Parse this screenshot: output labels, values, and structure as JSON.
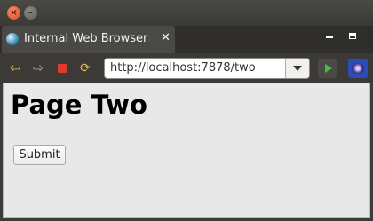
{
  "window": {
    "close_glyph": "×",
    "minimize_glyph": "–"
  },
  "tab": {
    "title": "Internal Web Browser",
    "close_glyph": "✕"
  },
  "toolbar": {
    "back_glyph": "⇦",
    "forward_glyph": "⇨",
    "refresh_glyph": "⟳",
    "url": "http://localhost:7878/two"
  },
  "page": {
    "heading": "Page Two",
    "submit_label": "Submit"
  },
  "colors": {
    "titlebar": "#3c3b37",
    "content_bg": "#e8e8e8",
    "close_button": "#df4a1f",
    "stop_button": "#e03a2c",
    "go_button": "#3fbf3f"
  }
}
